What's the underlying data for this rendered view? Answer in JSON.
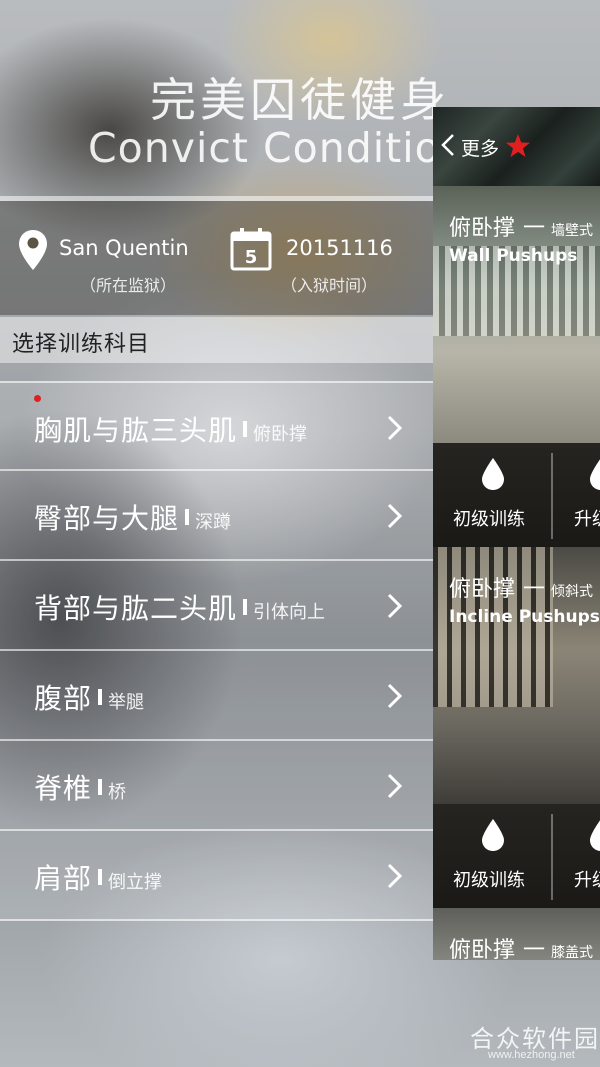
{
  "app": {
    "title_cn": "完美囚徒健身",
    "title_en": "Convict Condition"
  },
  "info": {
    "prison": {
      "value": "San Quentin",
      "caption": "（所在监狱）",
      "icon": "location-pin-icon"
    },
    "date": {
      "value": "20151116",
      "caption": "（入狱时间）",
      "icon": "calendar-icon",
      "calendar_day": "5"
    }
  },
  "section": {
    "title": "选择训练科目"
  },
  "training_items": [
    {
      "label": "胸肌与肱三头肌",
      "sub": "俯卧撑"
    },
    {
      "label": "臀部与大腿",
      "sub": "深蹲"
    },
    {
      "label": "背部与肱二头肌",
      "sub": "引体向上"
    },
    {
      "label": "腹部",
      "sub": "举腿"
    },
    {
      "label": "脊椎",
      "sub": "桥"
    },
    {
      "label": "肩部",
      "sub": "倒立撑"
    }
  ],
  "panel": {
    "back_label": "更多",
    "star_color": "#e02020",
    "cards": [
      {
        "title": "俯卧撑",
        "dash": "一",
        "type": "墙壁式",
        "subtitle": "Wall Pushups",
        "level_label": "初级训练",
        "level2_label": "升级"
      },
      {
        "title": "俯卧撑",
        "dash": "一",
        "type": "倾斜式",
        "subtitle": "Incline Pushups",
        "level_label": "初级训练",
        "level2_label": "升级"
      },
      {
        "title": "俯卧撑",
        "dash": "一",
        "type": "膝盖式"
      }
    ]
  },
  "watermark": {
    "text": "合众软件园",
    "url": "www.hezhong.net"
  },
  "colors": {
    "accent_red": "#e02020"
  }
}
